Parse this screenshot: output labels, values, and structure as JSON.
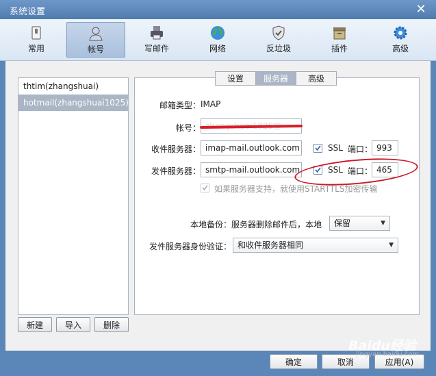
{
  "window": {
    "title": "系统设置",
    "close_glyph": "✕"
  },
  "toolbar": {
    "items": [
      {
        "label": "常用",
        "icon": "switch-icon"
      },
      {
        "label": "帐号",
        "icon": "user-icon"
      },
      {
        "label": "写邮件",
        "icon": "printer-icon"
      },
      {
        "label": "网络",
        "icon": "globe-icon"
      },
      {
        "label": "反垃圾",
        "icon": "shield-icon"
      },
      {
        "label": "插件",
        "icon": "box-icon"
      },
      {
        "label": "高级",
        "icon": "gear-icon"
      }
    ],
    "active": "帐号"
  },
  "accounts": {
    "items": [
      "thtim(zhangshuai)",
      "hotmail(zhangshuai1025)"
    ],
    "selected": "hotmail(zhangshuai1025)",
    "buttons": {
      "new": "新建",
      "import": "导入",
      "delete": "删除"
    }
  },
  "tabs": {
    "items": [
      "设置",
      "服务器",
      "高级"
    ],
    "active": "服务器"
  },
  "server": {
    "mailbox_type_label": "邮箱类型：",
    "mailbox_type_value": "IMAP",
    "account_label": "帐号：",
    "account_value": "zhangshuai1025@",
    "incoming_label": "收件服务器：",
    "incoming_value": "imap-mail.outlook.com",
    "incoming_ssl_label": "SSL",
    "incoming_port_label": "端口：",
    "incoming_port": "993",
    "outgoing_label": "发件服务器：",
    "outgoing_value": "smtp-mail.outlook.com",
    "outgoing_ssl_label": "SSL",
    "outgoing_port_label": "端口：",
    "outgoing_port": "465",
    "starttls_label": "如果服务器支持，就使用STARTTLS加密传输",
    "backup_label": "本地备份：",
    "backup_text": "服务器删除邮件后，本地",
    "backup_value": "保留",
    "auth_label": "发件服务器身份验证：",
    "auth_value": "和收件服务器相同"
  },
  "footer": {
    "ok": "确定",
    "cancel": "取消",
    "apply": "应用(A)"
  },
  "watermark": {
    "brand": "Baidu经验",
    "url": "jingyan.baidu.com"
  },
  "colors": {
    "titlebar": "#5a86b8",
    "selection": "#aab5c6",
    "annotation": "#d81e28"
  }
}
